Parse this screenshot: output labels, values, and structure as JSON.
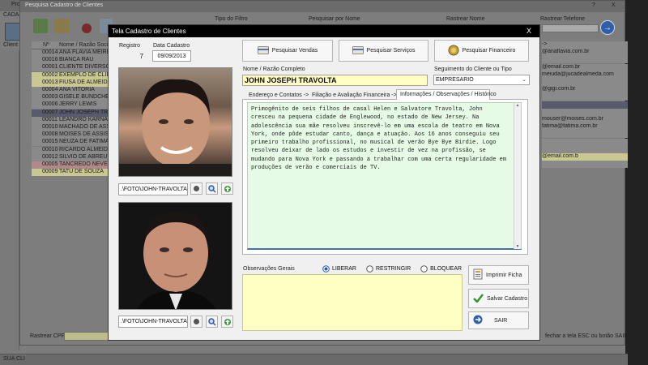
{
  "window": {
    "title_fragment": "Pro",
    "subtitle_fragment": "CADAS",
    "search_title": "Pesquisa Cadastro de Clientes",
    "help": "?",
    "close": "X",
    "toolbar_label": "Client"
  },
  "search_filters": {
    "tipo_filtro": "Tipo do Filtro",
    "pesquisar_nome": "Pesquisar por Nome",
    "rastrear_nome": "Rastrear Nome",
    "rastrear_telefone": "Rastrear Telefone",
    "rastrear_cpf": "Rastrear CPF"
  },
  "grid": {
    "col_n": "Nº",
    "col_nome": "Nome / Razão Soci",
    "rows": [
      {
        "n": "00014",
        "nome": "ANA FLAVIA MEIREL"
      },
      {
        "n": "00016",
        "nome": "BIANCA RAU"
      },
      {
        "n": "00001",
        "nome": "CLIENTE DIVERSOS"
      },
      {
        "n": "00002",
        "nome": "EXEMPLO DE CLIEN"
      },
      {
        "n": "00013",
        "nome": "FIUSA DE ALMEIDA"
      },
      {
        "n": "00004",
        "nome": "ANA VITORIA"
      },
      {
        "n": "00003",
        "nome": "GISELE BUNDCHEN"
      },
      {
        "n": "00006",
        "nome": "JERRY LEWIS"
      },
      {
        "n": "00007",
        "nome": "JOHN JOSEPH TRAV"
      },
      {
        "n": "00011",
        "nome": "LEANDRO KARNAL"
      },
      {
        "n": "00010",
        "nome": "MACHADO DE ASSIS"
      },
      {
        "n": "00008",
        "nome": "MOISES DE ASSIS"
      },
      {
        "n": "00015",
        "nome": "NEUZA DE FATIMA"
      },
      {
        "n": "00010",
        "nome": "RICARDO ALMEIDA"
      },
      {
        "n": "00012",
        "nome": "SILVIO DE ABREU"
      },
      {
        "n": "00005",
        "nome": "TANCREDO NEVES"
      },
      {
        "n": "00009",
        "nome": "TATU DE SOUZA"
      }
    ],
    "right_rows": [
      "->",
      "@anaflavia.com.br",
      "",
      "@email.com.br",
      "meiuda@jucadealmeda.com",
      "",
      "@gigi.com.br",
      "",
      "",
      "",
      "mouser@moises.com.br",
      "fatima@fatima.com.br",
      "",
      "",
      "",
      "@email.com.b",
      ""
    ],
    "status_bar": "SUA CLI",
    "hint": "fechar a tela ESC ou botão SAIR"
  },
  "modal": {
    "title": "Tela Cadastro de Clientes",
    "close": "X",
    "registro_label": "Registro",
    "registro_value": "7",
    "data_label": "Data Cadastro",
    "data_value": "09/09/2013",
    "btn_vendas": "Pesquisar Vendas",
    "btn_servicos": "Pesquisar Serviços",
    "btn_financeiro": "Pesquisar  Financeiro",
    "nome_label": "Nome / Razão Completo",
    "nome_value": "JOHN JOSEPH TRAVOLTA",
    "segmento_label": "Seguimento do Cliente ou Tipo",
    "segmento_value": "EMPRESARIO",
    "tab_endereco": "Endereço e Contatos ->",
    "tab_filiacao": "Filiação e Avaliação Financeira ->",
    "tab_info": "Informações / Observações / Histórico",
    "historico": "Primogênito de seis filhos de casal Helen e Salvatore Travolta, John cresceu na pequena cidade de Englewood, no estado de New Jersey. Na adolescência sua mãe resolveu inscrevê-lo em uma escola de teatro em Nova York, onde pôde estudar canto, dança e atuação. Aos 16 anos conseguiu seu primeiro trabalho profissional, no musical de verão Bye Bye Birdie. Logo resolveu deixar de lado os estudos e investir de vez na profissão, se mudando para Nova York e passando a trabalhar com uma certa regularidade em produções de verão e comerciais de TV.",
    "photo1_path": ".\\FOTO\\JOHN-TRAVOLTA1...",
    "photo2_path": ".\\FOTO\\JOHN-TRAVOLTA2...",
    "obs_label": "Observações Gerais",
    "radio_liberar": "LIBERAR",
    "radio_restringir": "RESTRINGIR",
    "radio_bloquear": "BLOQUEAR",
    "btn_imprimir": "Imprimir Ficha",
    "btn_salvar": "Salvar Cadastro",
    "btn_sair": "SAIR"
  },
  "colors": {
    "accent_yellow": "#ffffc4",
    "text_green": "#e6fbe6",
    "title_black": "#000000"
  }
}
